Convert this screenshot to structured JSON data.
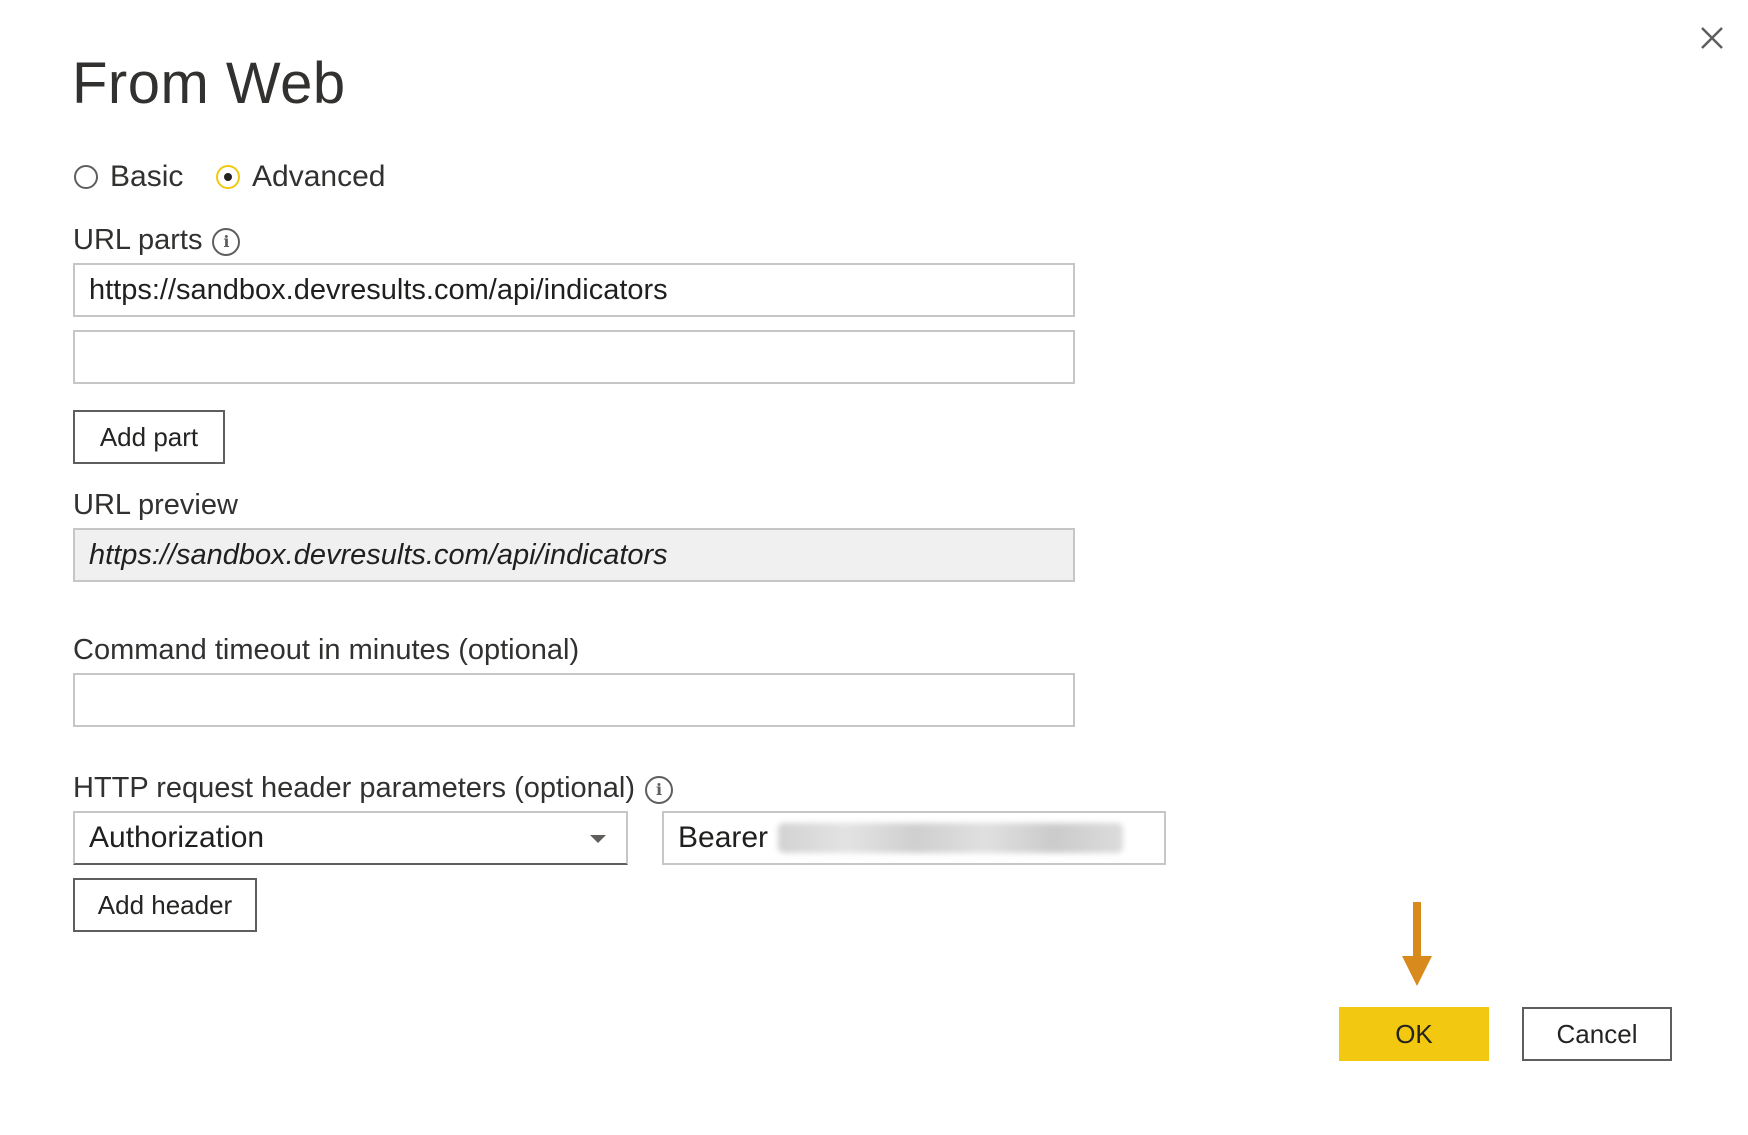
{
  "dialog": {
    "title": "From Web"
  },
  "mode": {
    "basic_label": "Basic",
    "advanced_label": "Advanced",
    "selected": "Advanced"
  },
  "url_parts": {
    "label": "URL parts",
    "part1_value": "https://sandbox.devresults.com/api/indicators",
    "part2_value": "",
    "add_part_label": "Add part"
  },
  "url_preview": {
    "label": "URL preview",
    "value": "https://sandbox.devresults.com/api/indicators"
  },
  "timeout": {
    "label": "Command timeout in minutes (optional)",
    "value": ""
  },
  "headers": {
    "label": "HTTP request header parameters (optional)",
    "name_value": "Authorization",
    "value_prefix": "Bearer",
    "add_header_label": "Add header"
  },
  "actions": {
    "ok_label": "OK",
    "cancel_label": "Cancel"
  },
  "colors": {
    "accent": "#f2c811",
    "annotation_arrow": "#d98a1c"
  },
  "icons": {
    "close": "close-icon",
    "info": "info-icon",
    "dropdown": "chevron-down-icon",
    "annotation": "arrow-down-icon"
  }
}
